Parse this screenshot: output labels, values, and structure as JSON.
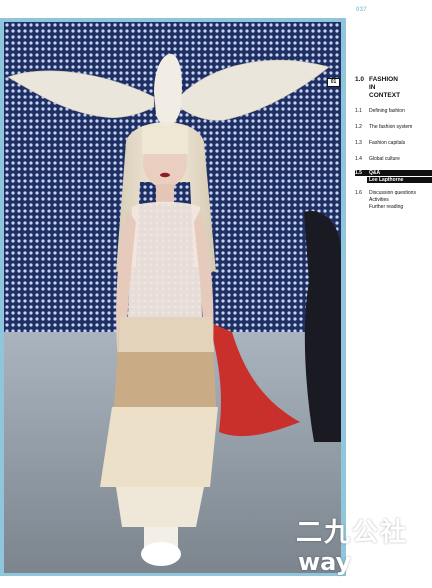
{
  "page_number": "037",
  "figure_tag": "01",
  "toc": {
    "number": "1.0",
    "title_lines": [
      "FASHION",
      "IN",
      "CONTEXT"
    ],
    "items": [
      {
        "num": "1.1",
        "label": "Defining fashion"
      },
      {
        "num": "1.2",
        "label": "The fashion system"
      },
      {
        "num": "1.3",
        "label": "Fashion capitals"
      },
      {
        "num": "1.4",
        "label": "Global culture"
      },
      {
        "num": "1.5",
        "label": "Q&A",
        "sub": "Lee Lapthorne"
      },
      {
        "num": "1.6",
        "label_lines": [
          "Discussion questions",
          "Activities",
          "Further reading"
        ]
      }
    ]
  },
  "watermark": {
    "top": "二九公社",
    "bottom": "way"
  },
  "colors": {
    "frame": "#8fc6db",
    "page_number": "#8ec9dc"
  }
}
